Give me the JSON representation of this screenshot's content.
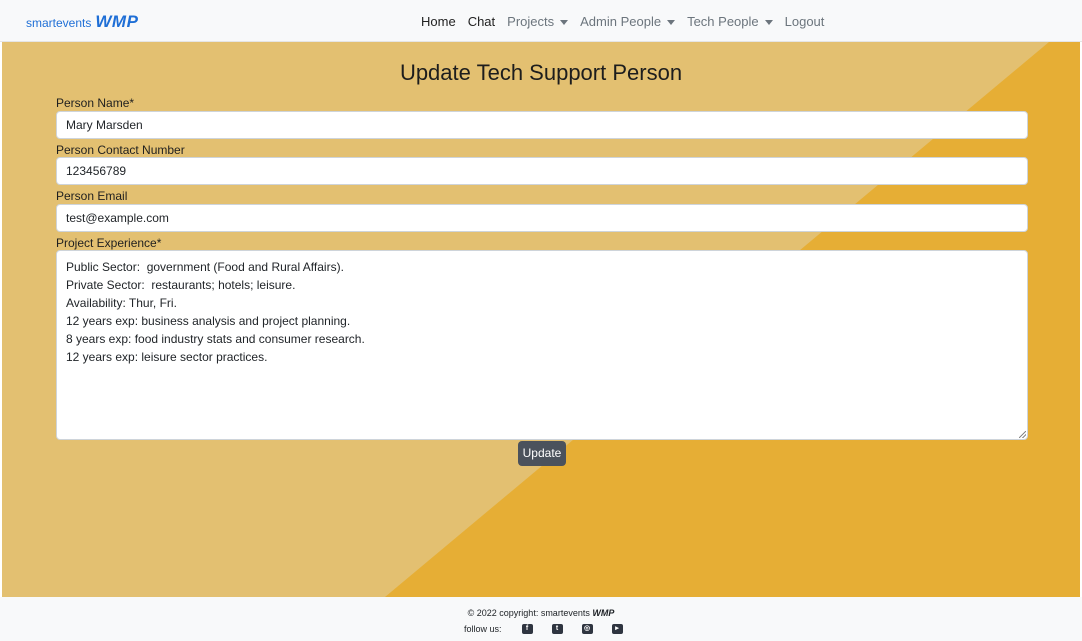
{
  "brand": {
    "small": "smartevents",
    "big": "WMP"
  },
  "nav": {
    "home": "Home",
    "chat": "Chat",
    "projects": "Projects",
    "admin_people": "Admin People",
    "tech_people": "Tech People",
    "logout": "Logout"
  },
  "form": {
    "title": "Update Tech Support Person",
    "name_label": "Person Name*",
    "name_value": "Mary Marsden",
    "contact_label": "Person Contact Number",
    "contact_value": "123456789",
    "email_label": "Person Email",
    "email_value": "test@example.com",
    "experience_label": "Project Experience*",
    "experience_lines": [
      "Public Sector:  government (Food and Rural Affairs).",
      "Private Sector:  restaurants; hotels; leisure.",
      "Availability: Thur, Fri.",
      "12 years exp: business analysis and project planning.",
      "8 years exp: food industry stats and consumer research.",
      "12 years exp: leisure sector practices."
    ],
    "update_label": "Update"
  },
  "footer": {
    "copyright": "© 2022 copyright: smartevents",
    "brand": "WMP",
    "follow": "follow us:"
  },
  "icons": [
    "facebook-icon",
    "twitter-icon",
    "instagram-icon",
    "youtube-icon"
  ],
  "colors": {
    "accent": "#1f6fd6",
    "background": "#e6ae35",
    "button": "#4b525c"
  }
}
